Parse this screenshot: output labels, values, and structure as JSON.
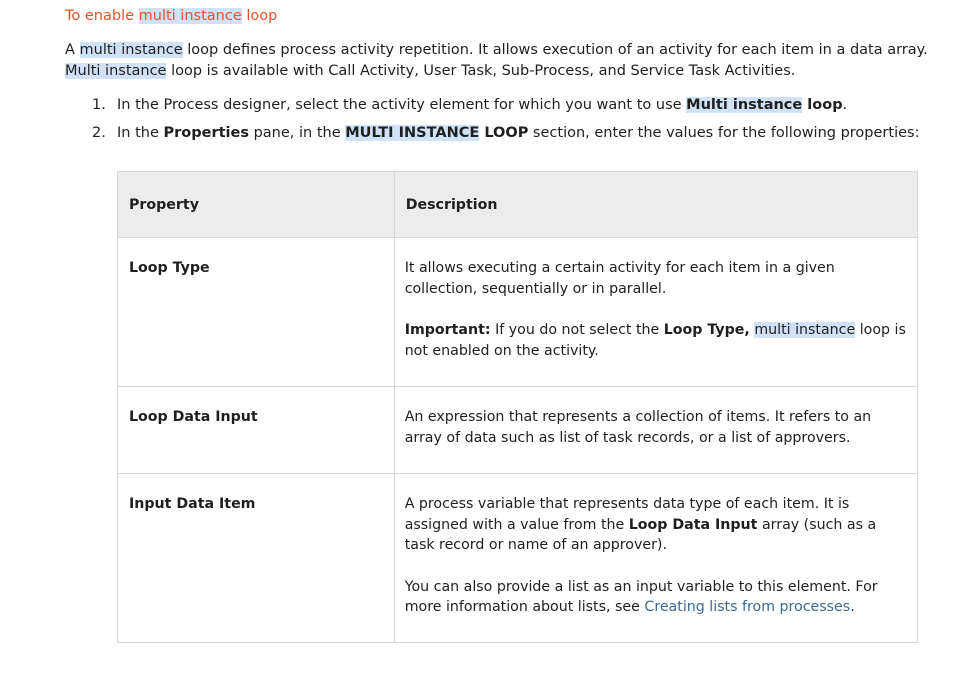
{
  "title": {
    "prefix": "To enable ",
    "highlight": "multi instance",
    "suffix": " loop"
  },
  "intro": {
    "line1_prefix": "A ",
    "line1_highlight": "multi instance",
    "line1_suffix": " loop defines process activity repetition. It allows execution of an activity for each item in a data array.",
    "line2_highlight": "Multi instance",
    "line2_suffix": " loop is available with Call Activity, User Task, Sub-Process, and Service Task Activities."
  },
  "steps": [
    {
      "num": "1.",
      "text_prefix": "In the Process designer, select the activity element for which you want to use ",
      "bold_highlight": "Multi instance",
      "bold_suffix": " loop",
      "end": "."
    },
    {
      "num": "2.",
      "t1": "In the ",
      "b1": "Properties",
      "t2": " pane, in the ",
      "b2_highlight": "MULTI INSTANCE",
      "b2_suffix": " LOOP",
      "t3": " section, enter the values for the following properties:"
    }
  ],
  "table": {
    "headers": [
      "Property",
      "Description"
    ],
    "rows": [
      {
        "property": "Loop Type",
        "desc1": " It allows executing a certain activity for each item in a given collection, sequentially or in parallel.",
        "important_label": "Important:",
        "important_t1": " If you do not select the ",
        "important_b1": "Loop Type,",
        "important_space": " ",
        "important_highlight": "multi instance",
        "important_t2": " loop is not enabled on the activity."
      },
      {
        "property": "Loop Data Input",
        "desc1": "An expression that represents a collection of items. It refers to an array of data such as list of task records, or a list of approvers."
      },
      {
        "property": "Input Data Item",
        "desc1_t1": "A process variable that represents data type of each item. It is assigned with a value from the ",
        "desc1_b1": "Loop Data Input",
        "desc1_t2": " array (such as a task record or name of an approver).",
        "desc2_t1": "You can also provide a list as an input variable to this element. For more information about lists, see ",
        "desc2_link": "Creating lists from processes",
        "desc2_t2": "."
      }
    ]
  },
  "colors": {
    "title": "#e4532a",
    "highlight": "#cfe2f7",
    "link": "#3c6a8f",
    "header_bg": "#ececec"
  }
}
